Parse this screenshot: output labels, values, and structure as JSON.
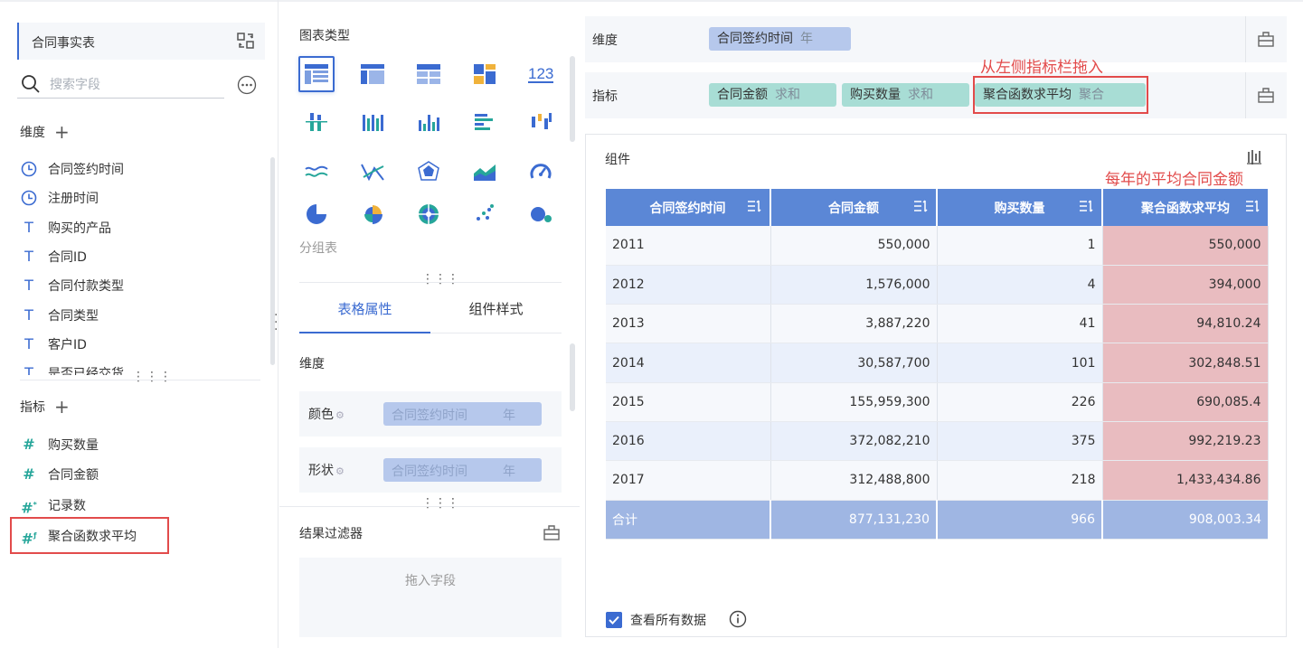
{
  "left": {
    "datasource": "合同事实表",
    "search_placeholder": "搜索字段",
    "dimension_title": "维度",
    "dimensions": [
      {
        "icon": "clock-icon",
        "label": "合同签约时间"
      },
      {
        "icon": "clock-icon",
        "label": "注册时间"
      },
      {
        "icon": "text-type-icon",
        "label": "购买的产品"
      },
      {
        "icon": "text-type-icon",
        "label": "合同ID"
      },
      {
        "icon": "text-type-icon",
        "label": "合同付款类型"
      },
      {
        "icon": "text-type-icon",
        "label": "合同类型"
      },
      {
        "icon": "text-type-icon",
        "label": "客户ID"
      },
      {
        "icon": "text-type-icon",
        "label": "是否已经交货"
      }
    ],
    "measure_title": "指标",
    "measures": [
      {
        "icon": "number-type-icon",
        "label": "购买数量"
      },
      {
        "icon": "number-type-icon",
        "label": "合同金额"
      },
      {
        "icon": "record-count-icon",
        "label": "记录数"
      },
      {
        "icon": "aggregate-function-icon",
        "label": "聚合函数求平均"
      }
    ]
  },
  "middle": {
    "chart_type_title": "图表类型",
    "group_label": "分组表",
    "tabs": [
      "表格属性",
      "组件样式"
    ],
    "dimension_label": "维度",
    "props": [
      {
        "label": "颜色",
        "field": "合同签约时间",
        "agg": "年"
      },
      {
        "label": "形状",
        "field": "合同签约时间",
        "agg": "年"
      }
    ],
    "filter_title": "结果过滤器",
    "dropzone_text": "拖入字段"
  },
  "right": {
    "dimension_bar": {
      "label": "维度",
      "pill": {
        "field": "合同签约时间",
        "agg": "年"
      }
    },
    "measure_bar": {
      "label": "指标",
      "pills": [
        {
          "field": "合同金额",
          "agg": "求和"
        },
        {
          "field": "购买数量",
          "agg": "求和"
        },
        {
          "field": "聚合函数求平均",
          "agg": "聚合"
        }
      ]
    },
    "annotation_drag": "从左侧指标栏拖入",
    "annotation_avg": "每年的平均合同金额",
    "component_title": "组件",
    "table": {
      "headers": [
        "合同签约时间",
        "合同金额",
        "购买数量",
        "聚合函数求平均"
      ],
      "rows": [
        [
          "2011",
          "550,000",
          "1",
          "550,000"
        ],
        [
          "2012",
          "1,576,000",
          "4",
          "394,000"
        ],
        [
          "2013",
          "3,887,220",
          "41",
          "94,810.24"
        ],
        [
          "2014",
          "30,587,700",
          "101",
          "302,848.51"
        ],
        [
          "2015",
          "155,959,300",
          "226",
          "690,085.4"
        ],
        [
          "2016",
          "372,082,210",
          "375",
          "992,219.23"
        ],
        [
          "2017",
          "312,488,800",
          "218",
          "1,433,434.86"
        ]
      ],
      "total": [
        "合计",
        "877,131,230",
        "966",
        "908,003.34"
      ]
    },
    "view_all_label": "查看所有数据"
  },
  "colors": {
    "accent": "#3b6bd1",
    "header": "#5b87d6",
    "highlight": "#e9bcc0",
    "annotation": "#e24b4b",
    "teal": "#26a69a"
  }
}
